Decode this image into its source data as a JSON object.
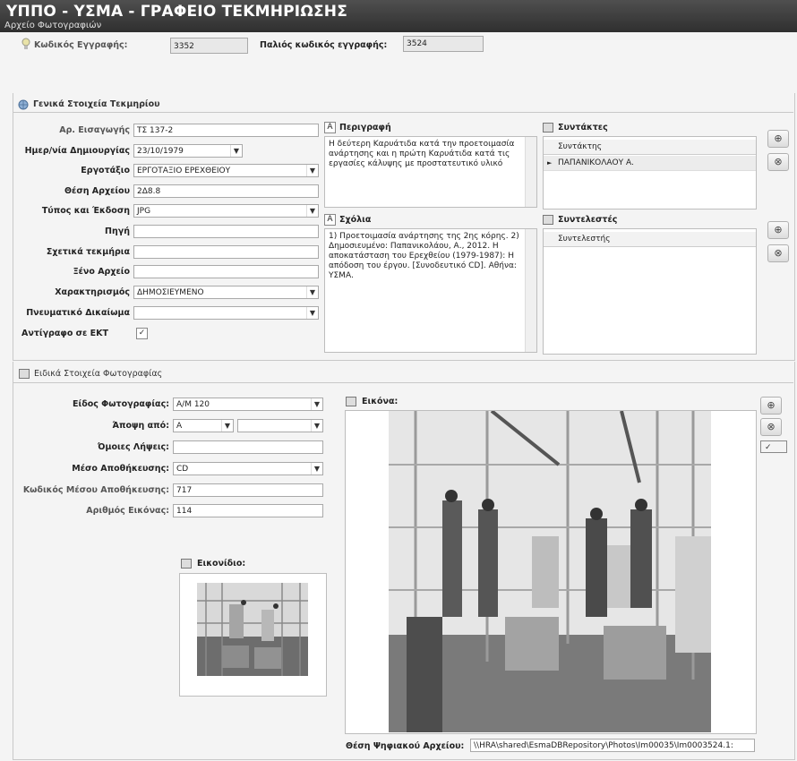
{
  "window": {
    "title": "ΥΠΠΟ - ΥΣΜΑ - ΓΡΑΦΕΙΟ ΤΕΚΜΗΡΙΩΣΗΣ",
    "subtitle": "Αρχείο Φωτογραφιών"
  },
  "record": {
    "code_label": "Κωδικός Εγγραφής:",
    "code_value": "3352",
    "old_code_label": "Παλιός κωδικός εγγραφής:",
    "old_code_value": "3524"
  },
  "general": {
    "header": "Γενικά Στοιχεία Τεκμηρίου",
    "fields": {
      "entry_no": {
        "label": "Αρ. Εισαγωγής",
        "value": "ΤΣ 137-2"
      },
      "created": {
        "label": "Ημερ/νία Δημιουργίας",
        "value": "23/10/1979"
      },
      "workshop": {
        "label": "Εργοτάξιο",
        "value": "ΕΡΓΟΤΑΞΙΟ ΕΡΕΧΘΕΙΟΥ"
      },
      "archive_pos": {
        "label": "Θέση Αρχείου",
        "value": "2Δ8.8"
      },
      "type_version": {
        "label": "Τύπος και Έκδοση",
        "value": "JPG"
      },
      "source": {
        "label": "Πηγή",
        "value": ""
      },
      "related": {
        "label": "Σχετικά τεκμήρια",
        "value": ""
      },
      "foreign": {
        "label": "Ξένο Αρχείο",
        "value": ""
      },
      "characterization": {
        "label": "Χαρακτηρισμός",
        "value": "ΔΗΜΟΣΙΕΥΜΕΝΟ"
      },
      "copyright": {
        "label": "Πνευματικό Δικαίωμα",
        "value": ""
      },
      "ekt_copy": {
        "label": "Αντίγραφο σε ΕΚΤ",
        "checked": "✓"
      }
    },
    "description": {
      "header": "Περιγραφή",
      "text": "Η δεύτερη Καρυάτιδα κατά την προετοιμασία ανάρτησης και η πρώτη Καρυάτιδα κατά τις εργασίες κάλυψης με προστατευτικό υλικό"
    },
    "comments": {
      "header": "Σχόλια",
      "text": "1) Προετοιμασία ανάρτησης της 2ης κόρης. 2) Δημοσιευμένο: Παπανικολάου, Α., 2012. Η αποκατάσταση του Ερεχθείου (1979-1987): Η απόδοση του έργου. [Συνοδευτικό CD]. Αθήνα: ΥΣΜΑ."
    },
    "authors": {
      "header": "Συντάκτες",
      "column": "Συντάκτης",
      "rows": [
        "ΠΑΠΑΝΙΚΟΛΑΟΥ Α."
      ]
    },
    "contributors": {
      "header": "Συντελεστές",
      "column": "Συντελεστής"
    }
  },
  "photo": {
    "header": "Ειδικά Στοιχεία Φωτογραφίας",
    "fields": {
      "kind": {
        "label": "Είδος Φωτογραφίας:",
        "value": "Α/Μ 120"
      },
      "view": {
        "label": "Άποψη από:",
        "value": "Α",
        "value2": ""
      },
      "similar": {
        "label": "Όμοιες Λήψεις:",
        "value": ""
      },
      "medium": {
        "label": "Μέσο Αποθήκευσης:",
        "value": "CD"
      },
      "medium_code": {
        "label": "Κωδικός Μέσου Αποθήκευσης:",
        "value": "717"
      },
      "image_no": {
        "label": "Αριθμός Εικόνας:",
        "value": "114"
      }
    },
    "thumbnail": {
      "header": "Εικονίδιο:"
    },
    "image": {
      "header": "Εικόνα:"
    },
    "digital_path": {
      "label": "Θέση Ψηφιακού Αρχείου:",
      "value": "\\\\HRA\\shared\\EsmaDBRepository\\Photos\\Im00035\\Im0003524.1:"
    }
  },
  "icons": {
    "bulb": "bulb-icon",
    "globe": "globe-icon",
    "add": "⊕",
    "remove": "⊗",
    "check": "✓",
    "dropdown": "▼",
    "arrow": "►",
    "text_icon": "A"
  }
}
